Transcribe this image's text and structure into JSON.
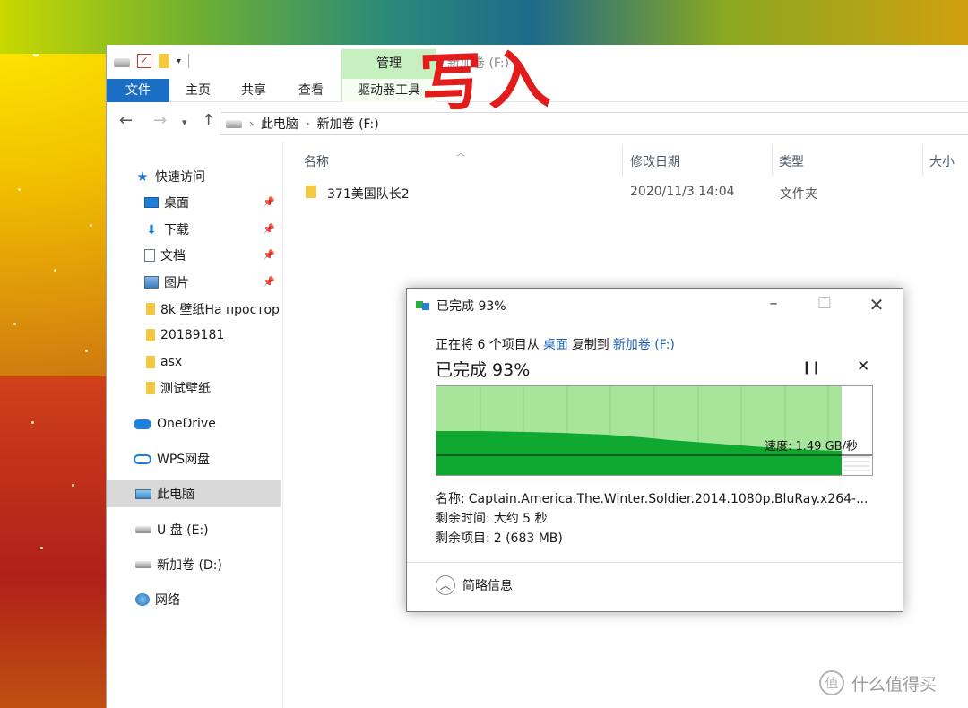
{
  "overlay": {
    "caption": "写入"
  },
  "explorer": {
    "window_title": "新加卷 (F:)",
    "context_tab": "管理",
    "ribbon_tabs": [
      "文件",
      "主页",
      "共享",
      "查看"
    ],
    "context_subtab": "驱动器工具",
    "address": {
      "crumbs": [
        "此电脑",
        "新加卷 (F:)"
      ]
    },
    "sidebar": {
      "quick_access": "快速访问",
      "pinned": [
        "桌面",
        "下载",
        "文档",
        "图片"
      ],
      "folders": [
        "8k 壁纸На простор",
        "20189181",
        "asx",
        "测试壁纸"
      ],
      "onedrive": "OneDrive",
      "wps": "WPS网盘",
      "this_pc": "此电脑",
      "drive_e": "U 盘 (E:)",
      "drive_d": "新加卷 (D:)",
      "network": "网络"
    },
    "columns": [
      "名称",
      "修改日期",
      "类型",
      "大小"
    ],
    "files": [
      {
        "name": "371美国队长2",
        "modified": "2020/11/3 14:04",
        "type": "文件夹",
        "size": ""
      }
    ]
  },
  "dialog": {
    "title": "已完成 93%",
    "progress_percent": 93,
    "line_prefix": "正在将 6 个项目从",
    "source": "桌面",
    "line_mid": "复制到",
    "destination": "新加卷 (F:)",
    "big_status": "已完成 93%",
    "speed": "速度: 1.49 GB/秒",
    "name_label": "名称:",
    "name_value": "Captain.America.The.Winter.Soldier.2014.1080p.BluRay.x264-...",
    "time_label": "剩余时间:",
    "time_value": "大约 5 秒",
    "items_label": "剩余项目:",
    "items_value": "2 (683 MB)",
    "less_details": "简略信息",
    "colors": {
      "graph_light": "#a6e59a",
      "graph_dark": "#0fa830",
      "speed_line": "#111111"
    }
  },
  "watermark": {
    "text": "什么值得买",
    "logo": "值"
  }
}
